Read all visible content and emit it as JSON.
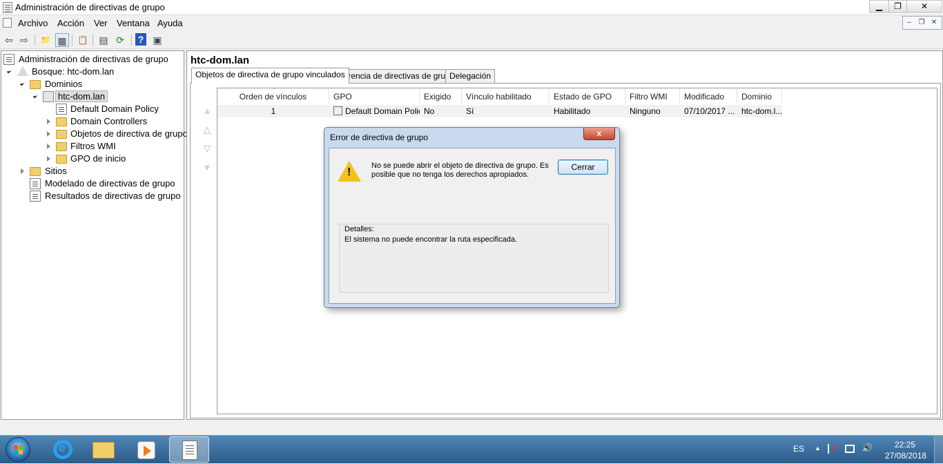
{
  "window": {
    "title": "Administración de directivas de grupo",
    "minimize": "▁",
    "maximize": "❐",
    "close": "✕"
  },
  "menu": [
    "Archivo",
    "Acción",
    "Ver",
    "Ventana",
    "Ayuda"
  ],
  "mdi": {
    "minimize": "–",
    "restore": "❐",
    "close": "✕"
  },
  "toolbar": {
    "back": "⇦",
    "forward": "⇨",
    "up": "📁",
    "show_hide": "▦",
    "properties": "📋",
    "export": "▤",
    "refresh": "⟳",
    "help": "?",
    "console": "▣"
  },
  "tree": {
    "root": "Administración de directivas de grupo",
    "forest": "Bosque: htc-dom.lan",
    "domains": "Dominios",
    "domain": "htc-dom.lan",
    "children": [
      "Default Domain Policy",
      "Domain Controllers",
      "Objetos de directiva de grupo",
      "Filtros WMI",
      "GPO de inicio"
    ],
    "sites": "Sitios",
    "modeling": "Modelado de directivas de grupo",
    "results": "Resultados de directivas de grupo"
  },
  "main": {
    "title": "htc-dom.lan",
    "tabs": [
      "Objetos de directiva de grupo vinculados",
      "Herencia de directivas de grupo",
      "Delegación"
    ],
    "order_arrows": [
      "⩓",
      "△",
      "▽",
      "⩔"
    ],
    "columns": [
      "Orden de vínculos",
      "GPO",
      "Exigido",
      "Vínculo habilitado",
      "Estado de GPO",
      "Filtro WMI",
      "Modificado",
      "Dominio"
    ],
    "sort_indicator": "^",
    "rows": [
      [
        "1",
        "Default Domain Policy",
        "No",
        "Sí",
        "Habilitado",
        "Ninguno",
        "07/10/2017 ...",
        "htc-dom.l..."
      ]
    ]
  },
  "dialog": {
    "title": "Error de directiva de grupo",
    "close_x": "x",
    "message": "No se puede abrir el objeto de directiva de grupo. Es posible que no tenga los derechos apropiados.",
    "button": "Cerrar",
    "warning_mark": "!",
    "details_label": "Detalles:",
    "details_text": "El sistema no puede encontrar la ruta especificada."
  },
  "taskbar": {
    "ie_glyph": "e",
    "language": "ES",
    "tray_arrow": "▲",
    "volume": "🔊",
    "time": "22:25",
    "date": "27/08/2018"
  }
}
